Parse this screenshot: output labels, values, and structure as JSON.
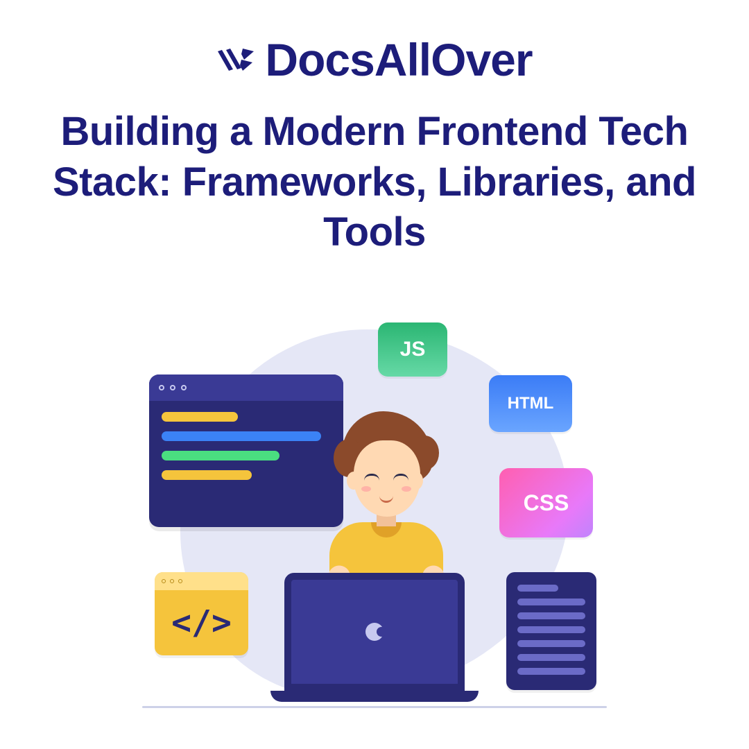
{
  "brand": {
    "name": "DocsAllOver"
  },
  "title": "Building a Modern Frontend Tech Stack: Frameworks, Libraries, and Tools",
  "badges": {
    "js": "JS",
    "html": "HTML",
    "css": "CSS"
  },
  "colors": {
    "primary": "#1d1d7a",
    "panel_dark": "#2a2a75",
    "yellow": "#f5c43c",
    "blob": "#e5e7f6"
  },
  "small_window_symbol": "</>"
}
